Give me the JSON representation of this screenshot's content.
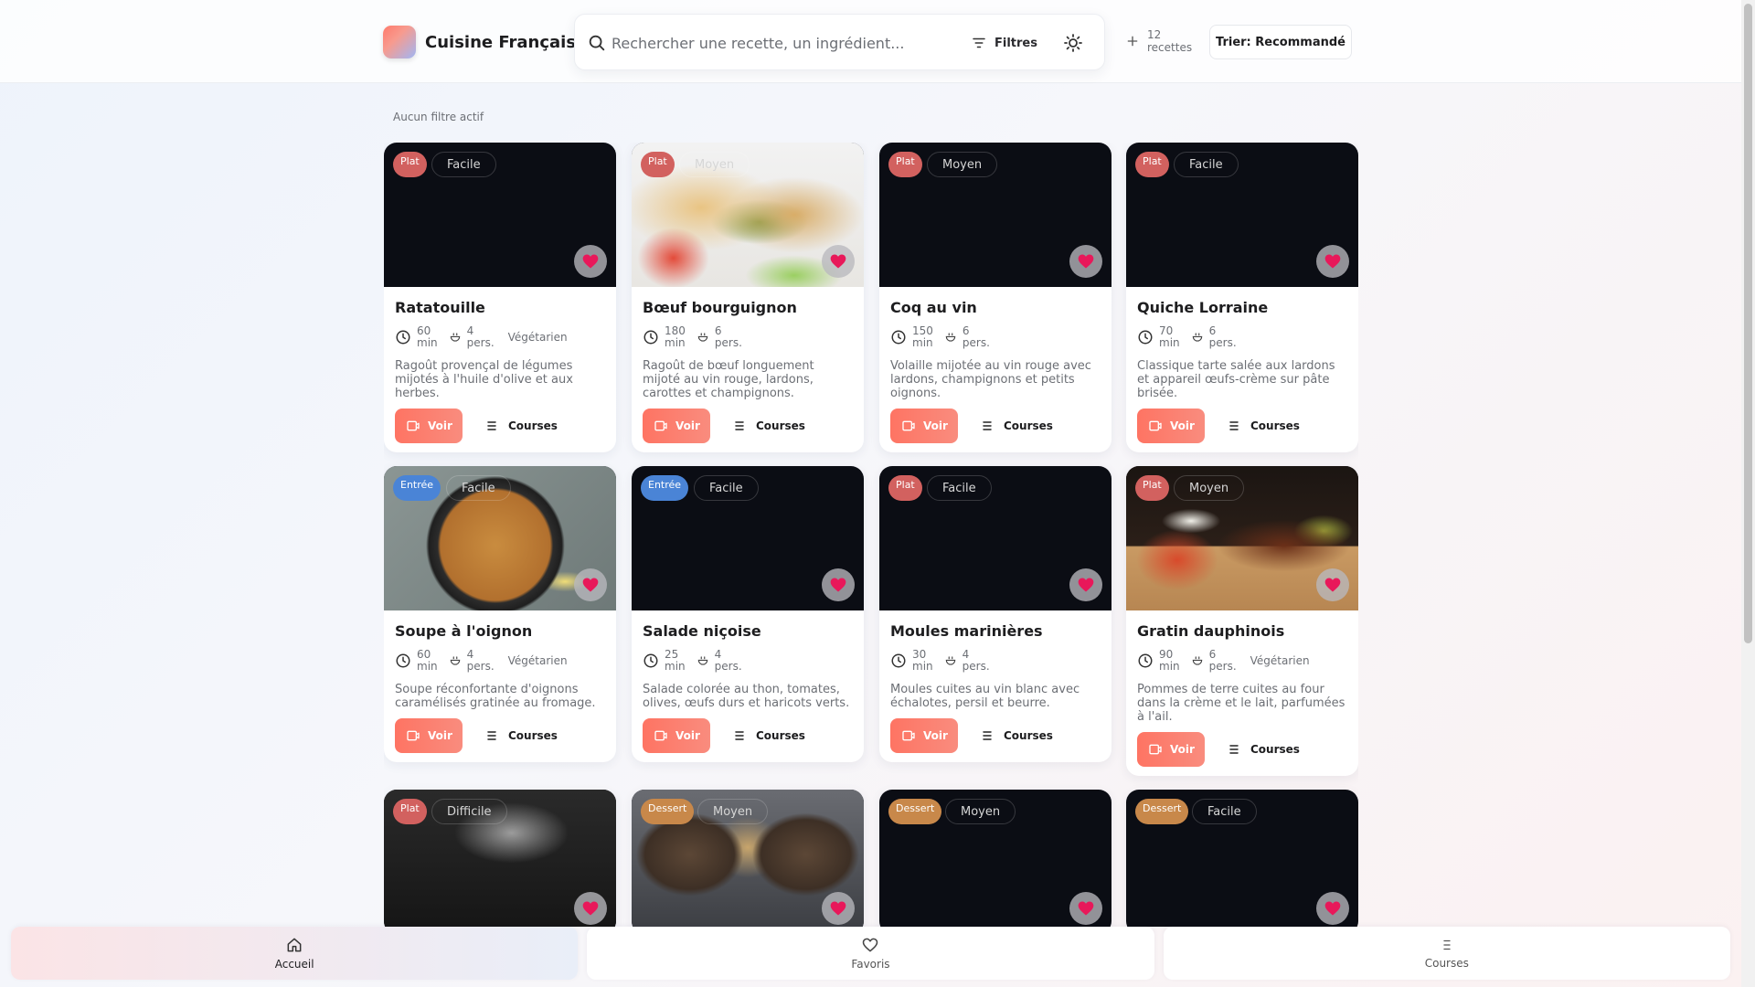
{
  "app": {
    "title": "Cuisine Française"
  },
  "search": {
    "placeholder": "Rechercher une recette, un ingrédient...",
    "value": ""
  },
  "toolbar": {
    "filters_label": "Filtres",
    "theme_icon": "sun-icon",
    "recipe_count_number": "12",
    "recipe_count_word": "recettes",
    "sort_label": "Trier: Recommandé"
  },
  "filter_status": "Aucun filtre actif",
  "colors": {
    "accent": "#fe7463",
    "plat": "#d2615f",
    "entree": "#4a84d6",
    "dessert": "#c8884a",
    "favorite": "#e8185a"
  },
  "recipes": [
    {
      "category": "Plat",
      "difficulty": "Facile",
      "title": "Ratatouille",
      "time": "60",
      "time_unit": "min",
      "servings": "4",
      "servings_unit": "pers.",
      "tag": "Végétarien",
      "description": "Ragoût provençal de légumes mijotés à l'huile d'olive et aux herbes.",
      "image": "dark"
    },
    {
      "category": "Plat",
      "difficulty": "Moyen",
      "title": "Bœuf bourguignon",
      "time": "180",
      "time_unit": "min",
      "servings": "6",
      "servings_unit": "pers.",
      "tag": "",
      "description": "Ragoût de bœuf longuement mijoté au vin rouge, lardons, carottes et champignons.",
      "image": "tacos"
    },
    {
      "category": "Plat",
      "difficulty": "Moyen",
      "title": "Coq au vin",
      "time": "150",
      "time_unit": "min",
      "servings": "6",
      "servings_unit": "pers.",
      "tag": "",
      "description": "Volaille mijotée au vin rouge avec lardons, champignons et petits oignons.",
      "image": "dark"
    },
    {
      "category": "Plat",
      "difficulty": "Facile",
      "title": "Quiche Lorraine",
      "time": "70",
      "time_unit": "min",
      "servings": "6",
      "servings_unit": "pers.",
      "tag": "",
      "description": "Classique tarte salée aux lardons et appareil œufs-crème sur pâte brisée.",
      "image": "dark"
    },
    {
      "category": "Entrée",
      "difficulty": "Facile",
      "title": "Soupe à l'oignon",
      "time": "60",
      "time_unit": "min",
      "servings": "4",
      "servings_unit": "pers.",
      "tag": "Végétarien",
      "description": "Soupe réconfortante d'oignons caramélisés gratinée au fromage.",
      "image": "paella"
    },
    {
      "category": "Entrée",
      "difficulty": "Facile",
      "title": "Salade niçoise",
      "time": "25",
      "time_unit": "min",
      "servings": "4",
      "servings_unit": "pers.",
      "tag": "",
      "description": "Salade colorée au thon, tomates, olives, œufs durs et haricots verts.",
      "image": "dark"
    },
    {
      "category": "Plat",
      "difficulty": "Facile",
      "title": "Moules marinières",
      "time": "30",
      "time_unit": "min",
      "servings": "4",
      "servings_unit": "pers.",
      "tag": "",
      "description": "Moules cuites au vin blanc avec échalotes, persil et beurre.",
      "image": "dark"
    },
    {
      "category": "Plat",
      "difficulty": "Moyen",
      "title": "Gratin dauphinois",
      "time": "90",
      "time_unit": "min",
      "servings": "6",
      "servings_unit": "pers.",
      "tag": "Végétarien",
      "description": "Pommes de terre cuites au four dans la crème et le lait, parfumées à l'ail.",
      "image": "ribs"
    },
    {
      "category": "Plat",
      "difficulty": "Difficile",
      "image": "neon"
    },
    {
      "category": "Dessert",
      "difficulty": "Moyen",
      "image": "bread"
    },
    {
      "category": "Dessert",
      "difficulty": "Moyen",
      "image": "dark"
    },
    {
      "category": "Dessert",
      "difficulty": "Facile",
      "image": "dark"
    }
  ],
  "card_actions": {
    "view_label": "Voir",
    "shopping_label": "Courses"
  },
  "bottom_nav": [
    {
      "label": "Accueil",
      "icon": "home-icon",
      "active": true
    },
    {
      "label": "Favoris",
      "icon": "heart-outline-icon",
      "active": false
    },
    {
      "label": "Courses",
      "icon": "list-icon",
      "active": false
    }
  ]
}
